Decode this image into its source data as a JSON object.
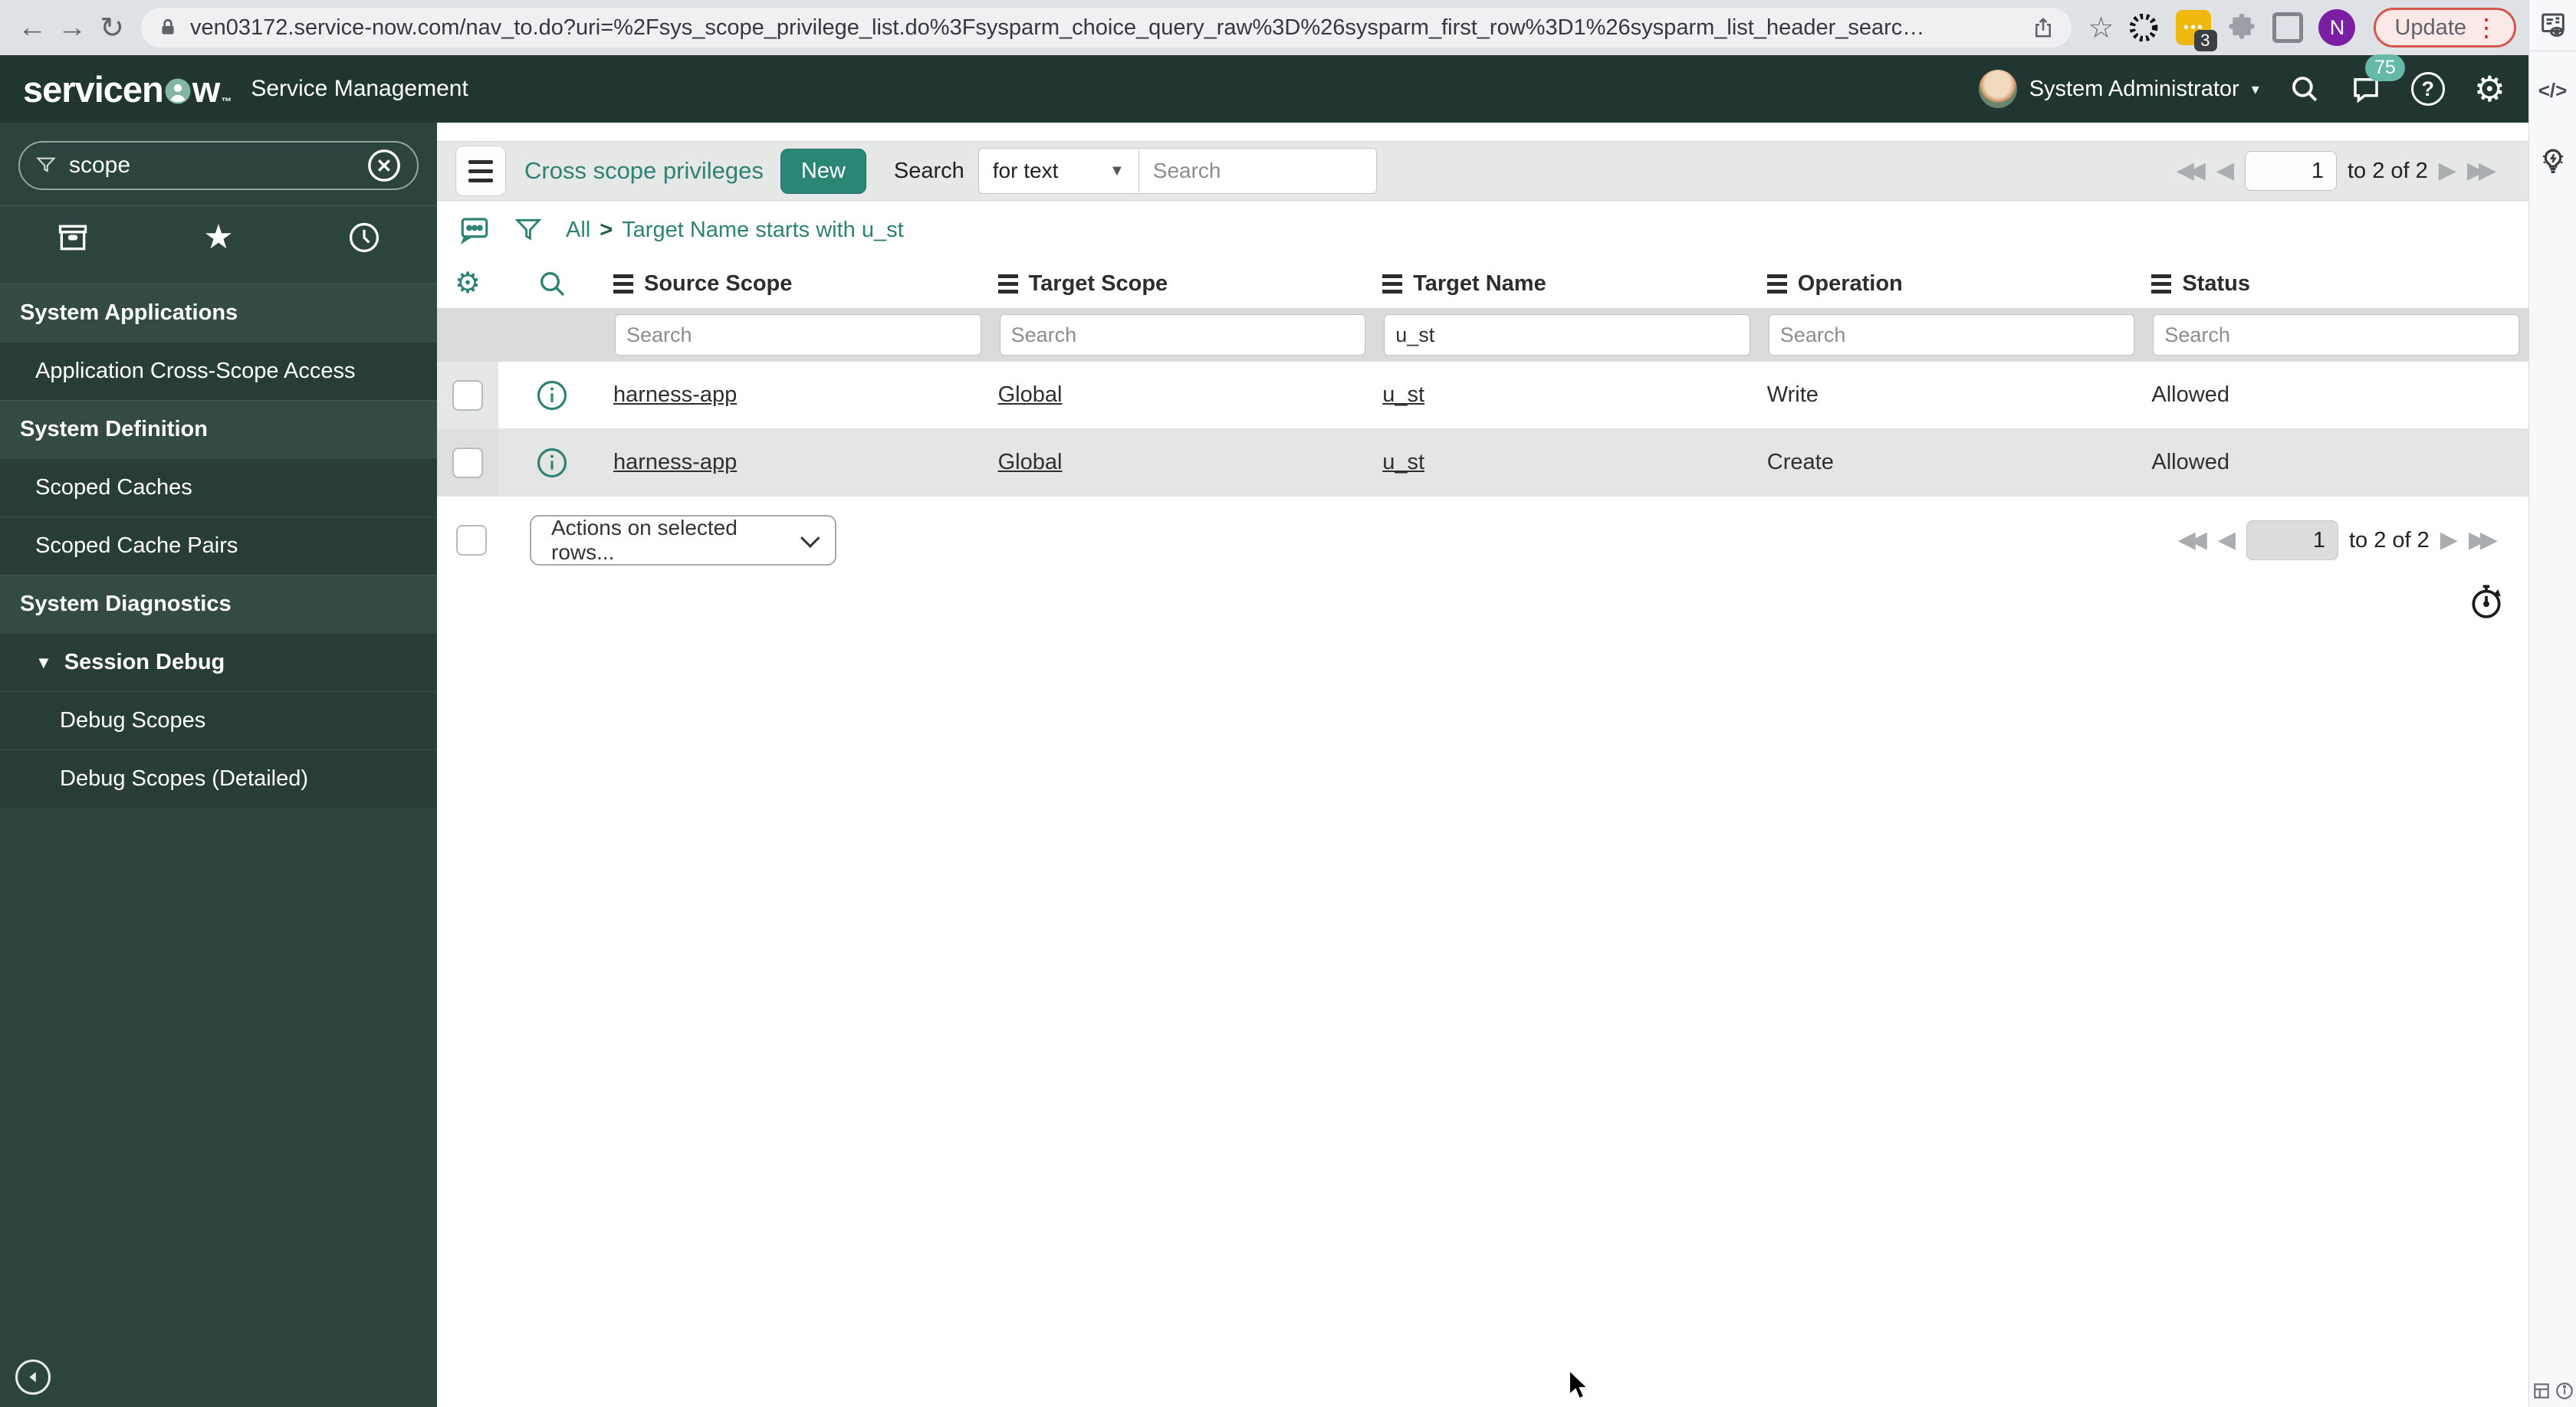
{
  "colors": {
    "accent_teal": "#2B8673",
    "header_bg": "#213631",
    "sidebar_bg": "#2C443E",
    "badge_green": "#66B9A8",
    "update_red": "#D5564A",
    "row_alt_bg": "#E4E6E5",
    "toolbar_bg": "#E5E8E7"
  },
  "icons": {
    "back": "←",
    "forward": "→",
    "reload": "↻",
    "star_outline": "☆",
    "ext_dots": "•••",
    "overflow_dots": "⋮",
    "caret_down": "▾",
    "triangle_down": "▼",
    "select_caret": "▼",
    "first": "◀◀",
    "prev": "◀",
    "next": "▶",
    "last": "▶▶",
    "gear": "⚙",
    "star": "★",
    "help": "?",
    "code": "</>"
  },
  "browser": {
    "url": "ven03172.service-now.com/nav_to.do?uri=%2Fsys_scope_privilege_list.do%3Fsysparm_choice_query_raw%3D%26sysparm_first_row%3D1%26sysparm_list_header_searc…",
    "extension_badge": "3",
    "avatar_initial": "N",
    "update_label": "Update"
  },
  "sn_header": {
    "logo_left": "servicen",
    "logo_right": "w",
    "logo_tm": "™",
    "product_label": "Service Management",
    "user_name": "System Administrator",
    "notification_count": "75"
  },
  "sidebar": {
    "filter_value": "scope",
    "items": [
      {
        "label": "System Applications",
        "type": "section"
      },
      {
        "label": "Application Cross-Scope Access",
        "type": "item"
      },
      {
        "label": "System Definition",
        "type": "section"
      },
      {
        "label": "Scoped Caches",
        "type": "item"
      },
      {
        "label": "Scoped Cache Pairs",
        "type": "item"
      },
      {
        "label": "System Diagnostics",
        "type": "section"
      },
      {
        "label": "Session Debug",
        "type": "subsection"
      },
      {
        "label": "Debug Scopes",
        "type": "subitem"
      },
      {
        "label": "Debug Scopes (Detailed)",
        "type": "subitem"
      }
    ]
  },
  "content": {
    "toolbar": {
      "title": "Cross scope privileges",
      "new_button": "New",
      "search_label": "Search",
      "search_type": "for text",
      "search_placeholder": "Search"
    },
    "pagination": {
      "page_value": "1",
      "range_label": "to 2 of 2"
    },
    "breadcrumb": {
      "root": "All",
      "separator": ">",
      "query": "Target Name starts with u_st"
    },
    "table": {
      "columns": [
        "Source Scope",
        "Target Scope",
        "Target Name",
        "Operation",
        "Status"
      ],
      "filters": [
        {
          "placeholder": "Search",
          "value": ""
        },
        {
          "placeholder": "Search",
          "value": ""
        },
        {
          "placeholder": "Search",
          "value": "u_st"
        },
        {
          "placeholder": "Search",
          "value": ""
        },
        {
          "placeholder": "Search",
          "value": ""
        }
      ],
      "rows": [
        {
          "source_scope": "harness-app",
          "target_scope": "Global",
          "target_name": "u_st",
          "operation": "Write",
          "status": "Allowed"
        },
        {
          "source_scope": "harness-app",
          "target_scope": "Global",
          "target_name": "u_st",
          "operation": "Create",
          "status": "Allowed"
        }
      ]
    },
    "actions_select_label": "Actions on selected rows..."
  }
}
